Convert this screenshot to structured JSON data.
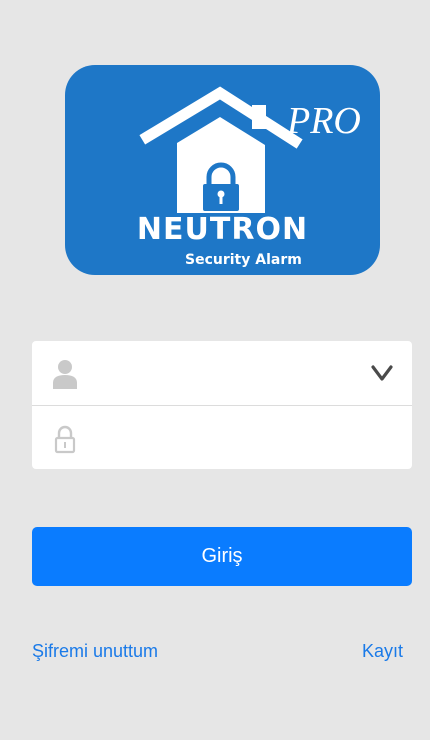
{
  "colors": {
    "background": "#e6e6e6",
    "logo_blue": "#1e77c7",
    "primary_button": "#0a7cff",
    "link": "#1a7ae8"
  },
  "logo": {
    "brand": "NEUTRON",
    "tagline": "Security Alarm",
    "edition": "PRO",
    "icons": [
      "house-icon",
      "padlock-icon"
    ]
  },
  "form": {
    "username": {
      "icon": "user-icon",
      "value": "",
      "placeholder": "",
      "dropdown_icon": "chevron-down-icon"
    },
    "password": {
      "icon": "lock-icon",
      "value": "",
      "placeholder": ""
    }
  },
  "actions": {
    "login_label": "Giriş",
    "forgot_password_label": "Şifremi unuttum",
    "register_label": "Kayıt"
  }
}
